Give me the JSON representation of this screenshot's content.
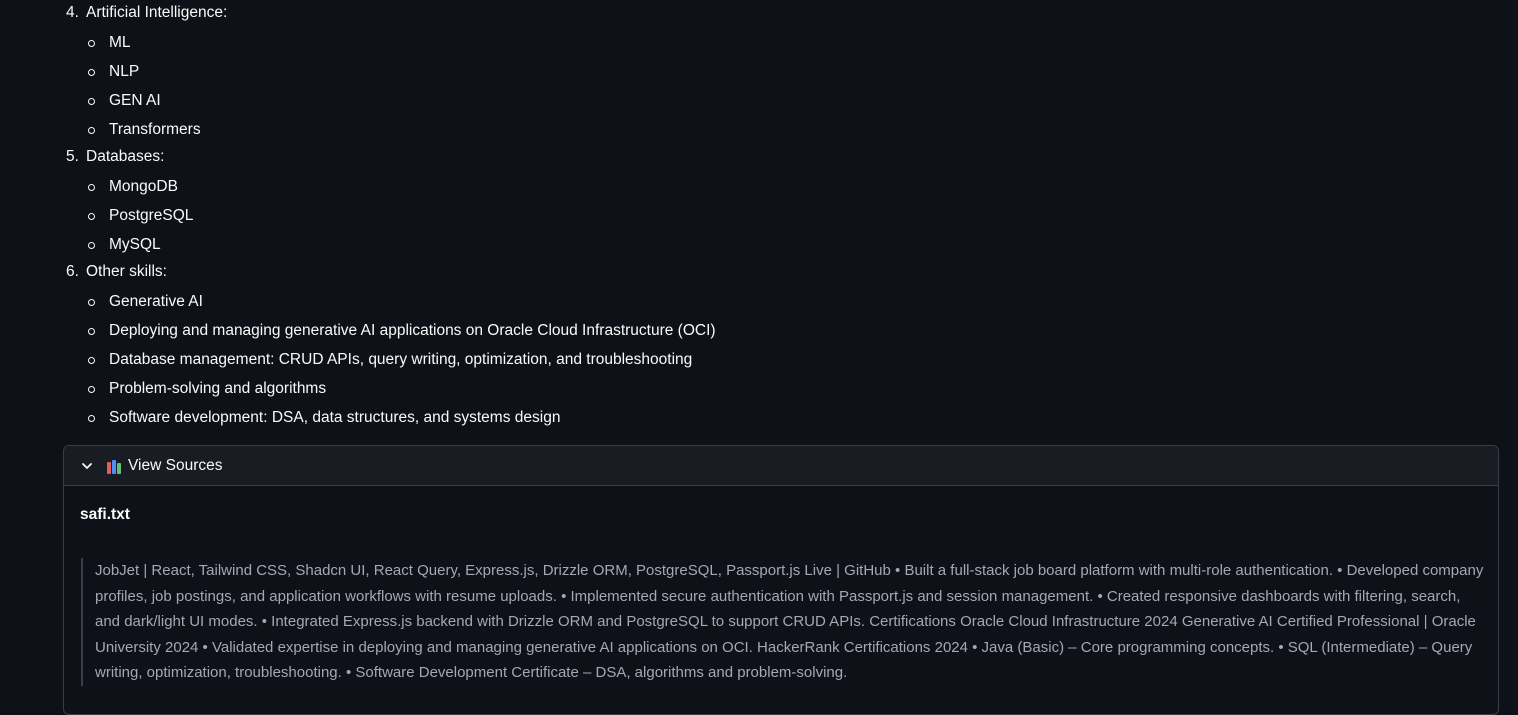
{
  "skills": [
    {
      "num": "4.",
      "title": "Artificial Intelligence:",
      "items": [
        "ML",
        "NLP",
        "GEN AI",
        "Transformers"
      ]
    },
    {
      "num": "5.",
      "title": "Databases:",
      "items": [
        "MongoDB",
        "PostgreSQL",
        "MySQL"
      ]
    },
    {
      "num": "6.",
      "title": "Other skills:",
      "items": [
        "Generative AI",
        "Deploying and managing generative AI applications on Oracle Cloud Infrastructure (OCI)",
        "Database management: CRUD APIs, query writing, optimization, and troubleshooting",
        "Problem-solving and algorithms",
        "Software development: DSA, data structures, and systems design"
      ]
    }
  ],
  "sources": {
    "label": "View Sources",
    "icon": "books-icon",
    "expanded": true,
    "file_name": "safi.txt",
    "excerpt": "JobJet | React, Tailwind CSS, Shadcn UI, React Query, Express.js, Drizzle ORM, PostgreSQL, Passport.js Live | GitHub • Built a full-stack job board platform with multi-role authentication. • Developed company profiles, job postings, and application workflows with resume uploads. • Implemented secure authentication with Passport.js and session management. • Created responsive dashboards with filtering, search, and dark/light UI modes. • Integrated Express.js backend with Drizzle ORM and PostgreSQL to support CRUD APIs. Certifications Oracle Cloud Infrastructure 2024 Generative AI Certified Professional | Oracle University 2024 • Validated expertise in deploying and managing generative AI applications on OCI. HackerRank Certifications 2024 • Java (Basic) – Core programming concepts. • SQL (Intermediate) – Query writing, optimization, troubleshooting. • Software Development Certificate – DSA, algorithms and problem-solving."
  },
  "colors": {
    "background": "#0e1117",
    "text": "#fafafa",
    "muted_text": "#a3a8b4",
    "border": "#3a3d47"
  }
}
